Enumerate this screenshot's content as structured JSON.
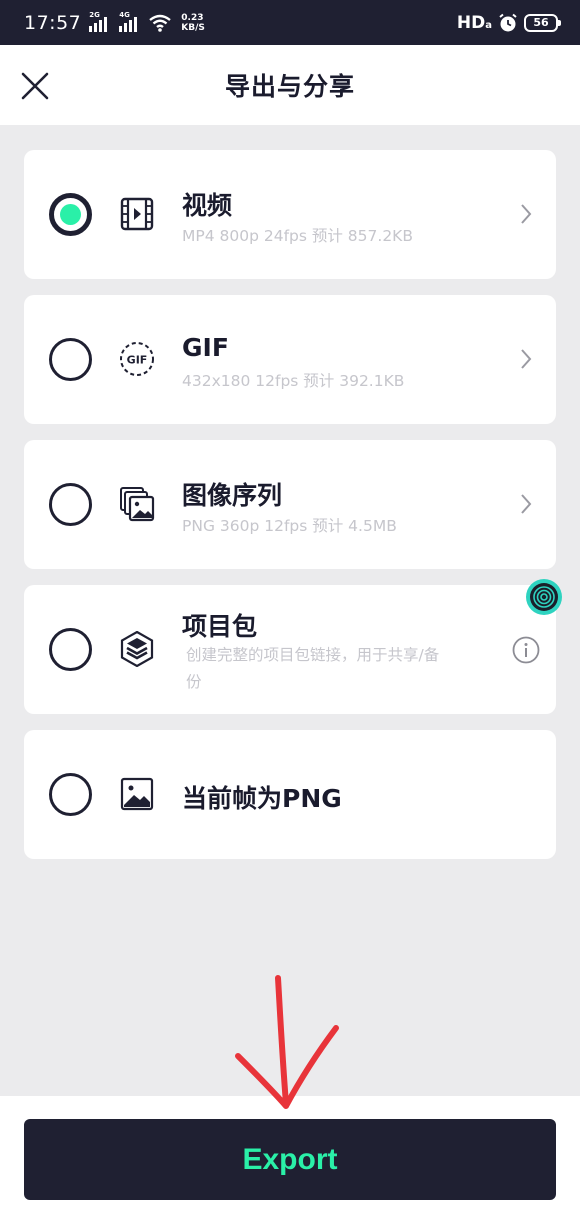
{
  "status_bar": {
    "time": "17:57",
    "signal1_tag": "2G",
    "signal2_tag": "4G",
    "net_speed_value": "0.23",
    "net_speed_unit": "KB/S",
    "hd_label": "HD",
    "hd_sub": "a",
    "battery": "56"
  },
  "header": {
    "title": "导出与分享"
  },
  "options": [
    {
      "title": "视频",
      "desc": "MP4 800p 24fps 预计 857.2KB",
      "selected": true,
      "icon": "video-icon"
    },
    {
      "title": "GIF",
      "desc": "432x180 12fps 预计 392.1KB",
      "selected": false,
      "icon": "gif-icon",
      "icon_text": "GIF"
    },
    {
      "title": "图像序列",
      "desc": "PNG 360p 12fps 预计 4.5MB",
      "selected": false,
      "icon": "image-sequence-icon"
    },
    {
      "title": "项目包",
      "desc_line1": "创建完整的项目包链接，用于共享/备",
      "desc_line2": "份",
      "selected": false,
      "icon": "layers-icon"
    },
    {
      "title": "当前帧为PNG",
      "selected": false,
      "icon": "image-icon"
    }
  ],
  "export_button": {
    "label": "Export"
  },
  "colors": {
    "accent": "#2af0a8",
    "dark": "#1f2032",
    "background": "#ebebed",
    "annotation": "#e8343a"
  }
}
